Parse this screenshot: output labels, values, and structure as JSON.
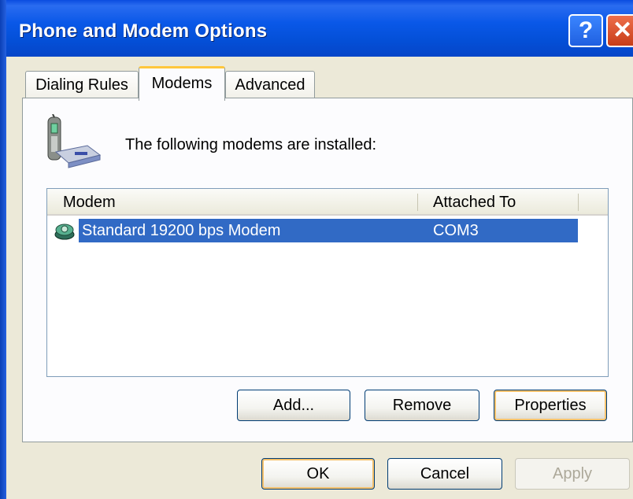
{
  "window": {
    "title": "Phone and Modem Options"
  },
  "title_buttons": {
    "help_label": "?",
    "close_label": "✕"
  },
  "tabs": [
    {
      "label": "Dialing Rules",
      "active": false
    },
    {
      "label": "Modems",
      "active": true
    },
    {
      "label": "Advanced",
      "active": false
    }
  ],
  "panel": {
    "icon": "modem-phone-icon",
    "intro_text": "The following modems are  installed:",
    "intro_mnemonic_index": 14
  },
  "modem_list": {
    "columns": [
      "Modem",
      "Attached To"
    ],
    "rows": [
      {
        "icon": "modem-icon",
        "modem": "Standard 19200 bps Modem",
        "attached_to": "COM3",
        "selected": true
      }
    ]
  },
  "panel_buttons": {
    "add": "Add...",
    "remove": "Remove",
    "properties": "Properties"
  },
  "dialog_buttons": {
    "ok": "OK",
    "cancel": "Cancel",
    "apply": "Apply"
  },
  "colors": {
    "title_bar": "#0a58e8",
    "selection": "#316ac5",
    "tab_highlight": "#ffc73c",
    "close_button": "#c83d18"
  }
}
